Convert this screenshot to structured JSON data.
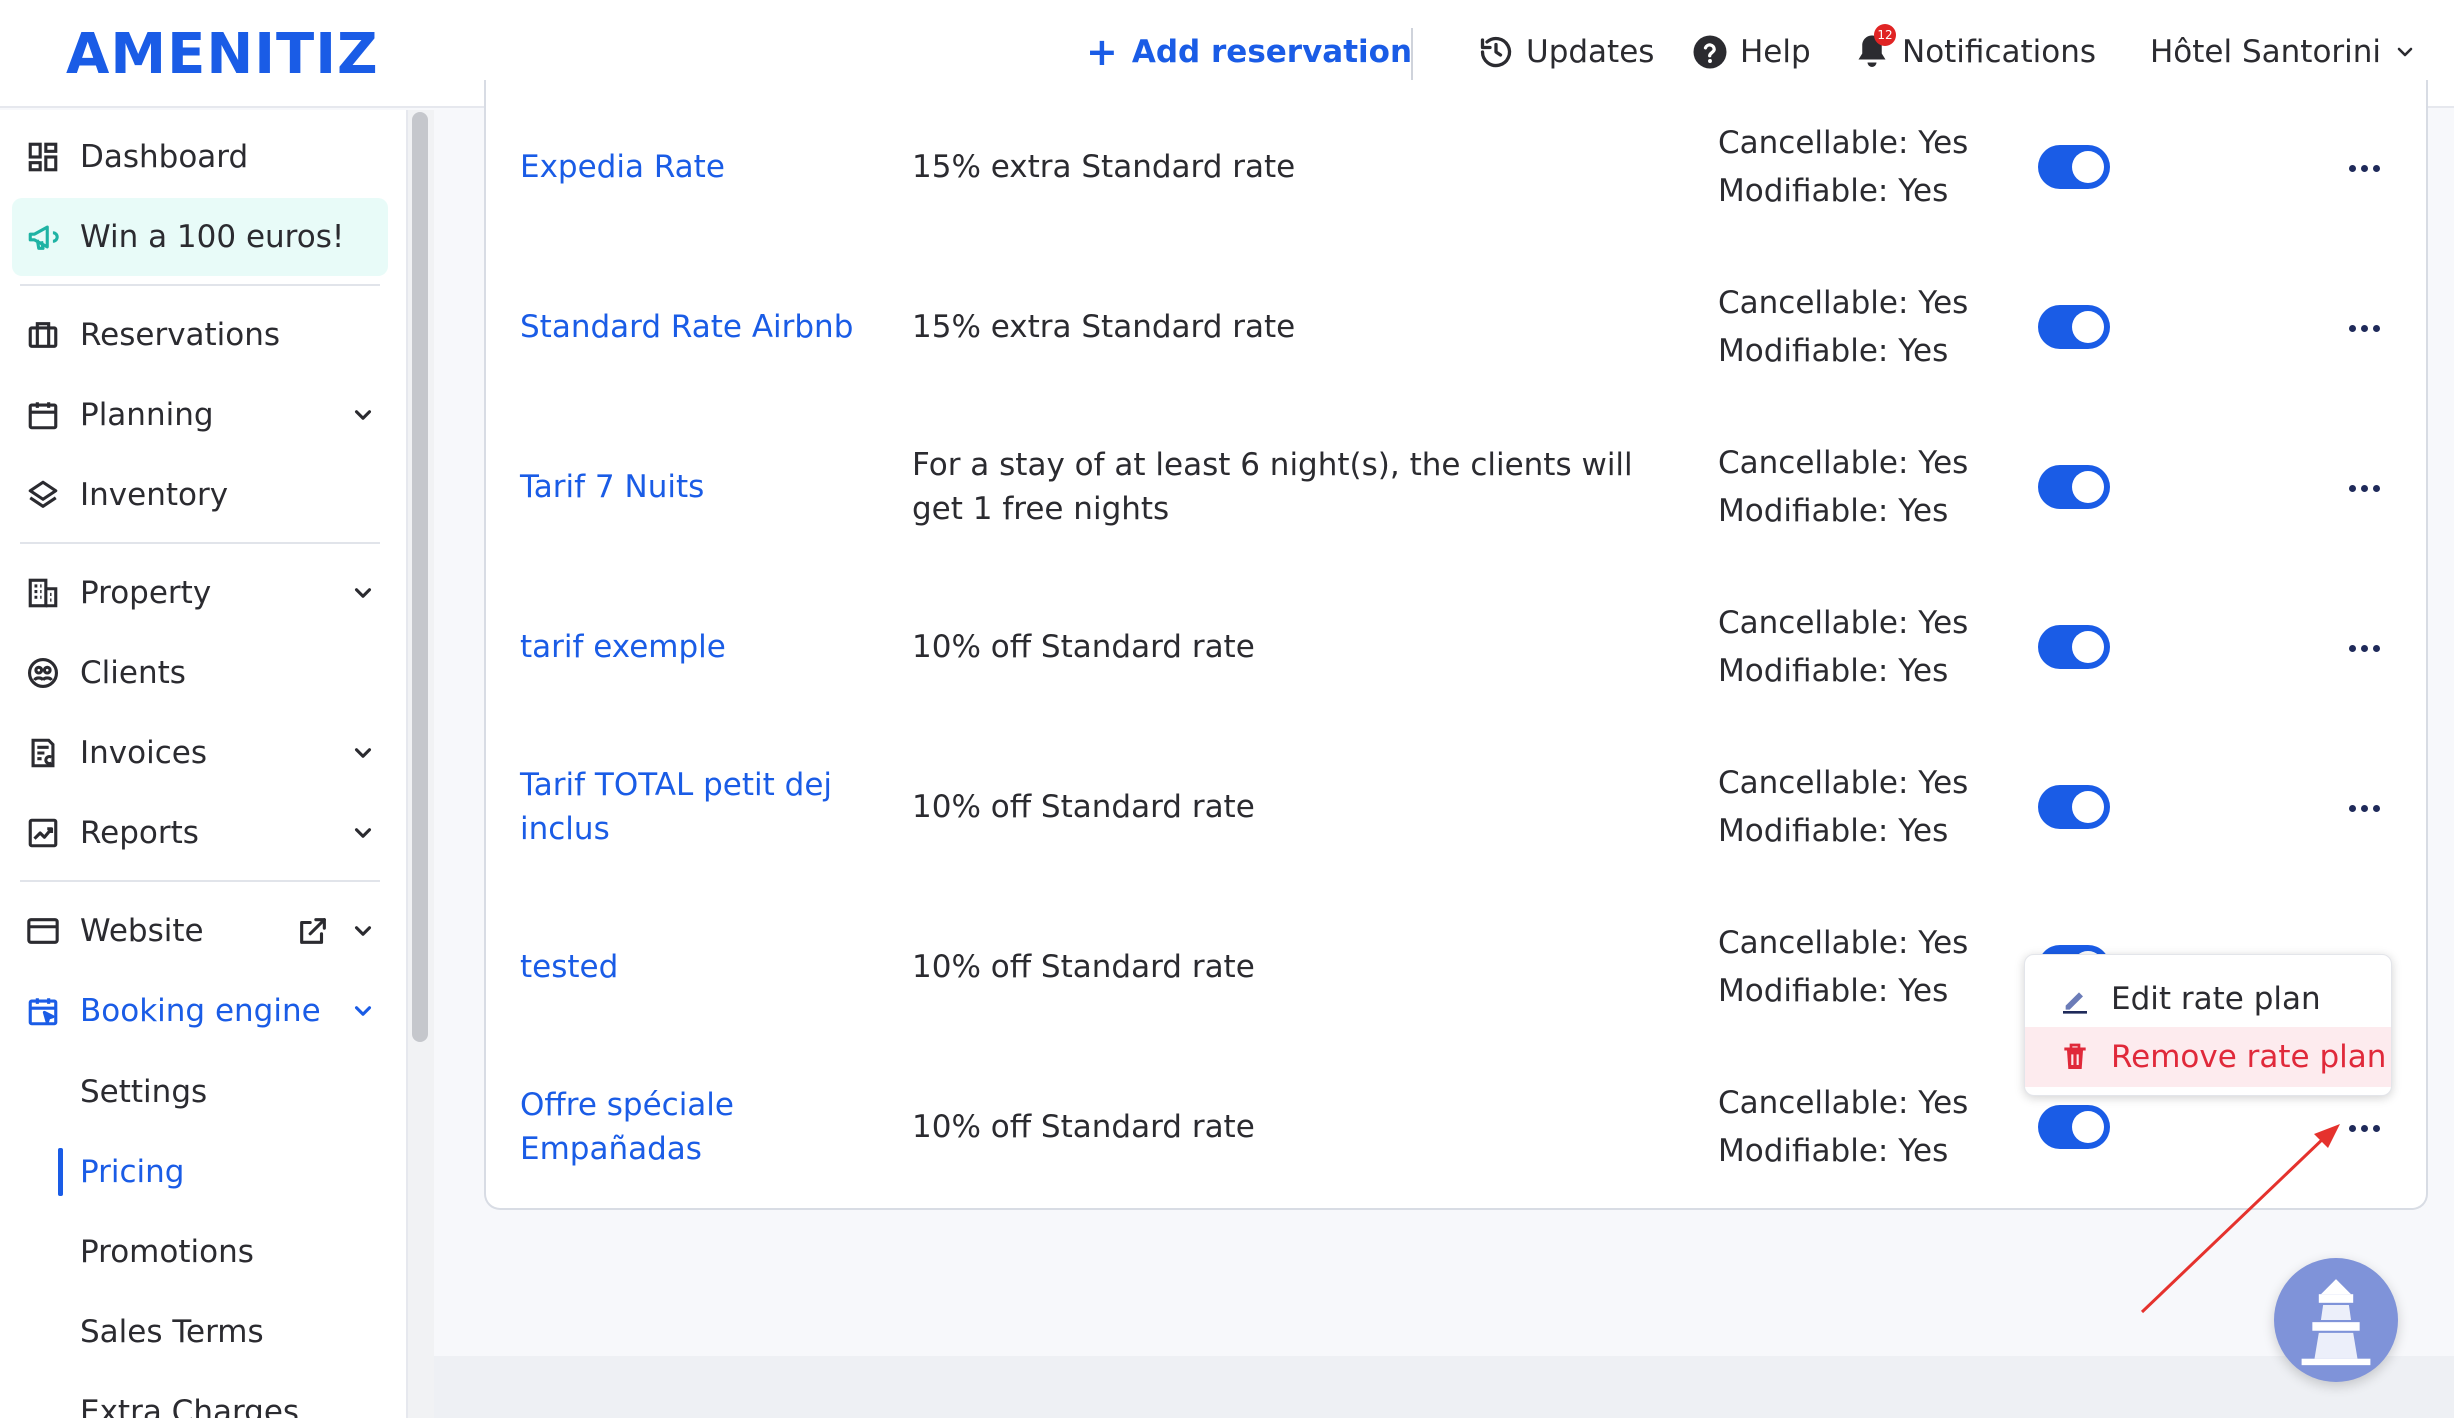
{
  "header": {
    "logo": "AMENITIZ",
    "add_reservation": "Add reservation",
    "updates": "Updates",
    "help": "Help",
    "notifications": "Notifications",
    "notifications_count": "12",
    "hotel": "Hôtel Santorini"
  },
  "sidebar": {
    "dashboard": "Dashboard",
    "promo": "Win a 100 euros!",
    "reservations": "Reservations",
    "planning": "Planning",
    "inventory": "Inventory",
    "property": "Property",
    "clients": "Clients",
    "invoices": "Invoices",
    "reports": "Reports",
    "website": "Website",
    "booking_engine": "Booking engine",
    "sub": {
      "settings": "Settings",
      "pricing": "Pricing",
      "promotions": "Promotions",
      "sales_terms": "Sales Terms",
      "extra_charges": "Extra Charges"
    }
  },
  "rate_plans": [
    {
      "name": "Expedia Rate",
      "desc": "15% extra Standard rate",
      "cancellable": "Cancellable: Yes",
      "modifiable": "Modifiable: Yes",
      "enabled": true
    },
    {
      "name": "Standard Rate Airbnb",
      "desc": "15% extra Standard rate",
      "cancellable": "Cancellable: Yes",
      "modifiable": "Modifiable: Yes",
      "enabled": true
    },
    {
      "name": "Tarif 7 Nuits",
      "desc": "For a stay of at least 6 night(s), the clients will get 1 free nights",
      "cancellable": "Cancellable: Yes",
      "modifiable": "Modifiable: Yes",
      "enabled": true
    },
    {
      "name": "tarif exemple",
      "desc": "10% off Standard rate",
      "cancellable": "Cancellable: Yes",
      "modifiable": "Modifiable: Yes",
      "enabled": true
    },
    {
      "name": "Tarif TOTAL petit dej inclus",
      "desc": "10% off Standard rate",
      "cancellable": "Cancellable: Yes",
      "modifiable": "Modifiable: Yes",
      "enabled": true
    },
    {
      "name": "tested",
      "desc": "10% off Standard rate",
      "cancellable": "Cancellable: Yes",
      "modifiable": "Modifiable: Yes",
      "enabled": true
    },
    {
      "name": "Offre spéciale Empañadas",
      "desc": "10% off Standard rate",
      "cancellable": "Cancellable: Yes",
      "modifiable": "Modifiable: Yes",
      "enabled": true
    }
  ],
  "menu": {
    "edit": "Edit rate plan",
    "remove": "Remove rate plan"
  },
  "colors": {
    "brand": "#1a5ce6",
    "danger": "#e0293a",
    "promo_bg": "#e8fbf8",
    "annotation_arrow": "#e5322d"
  }
}
